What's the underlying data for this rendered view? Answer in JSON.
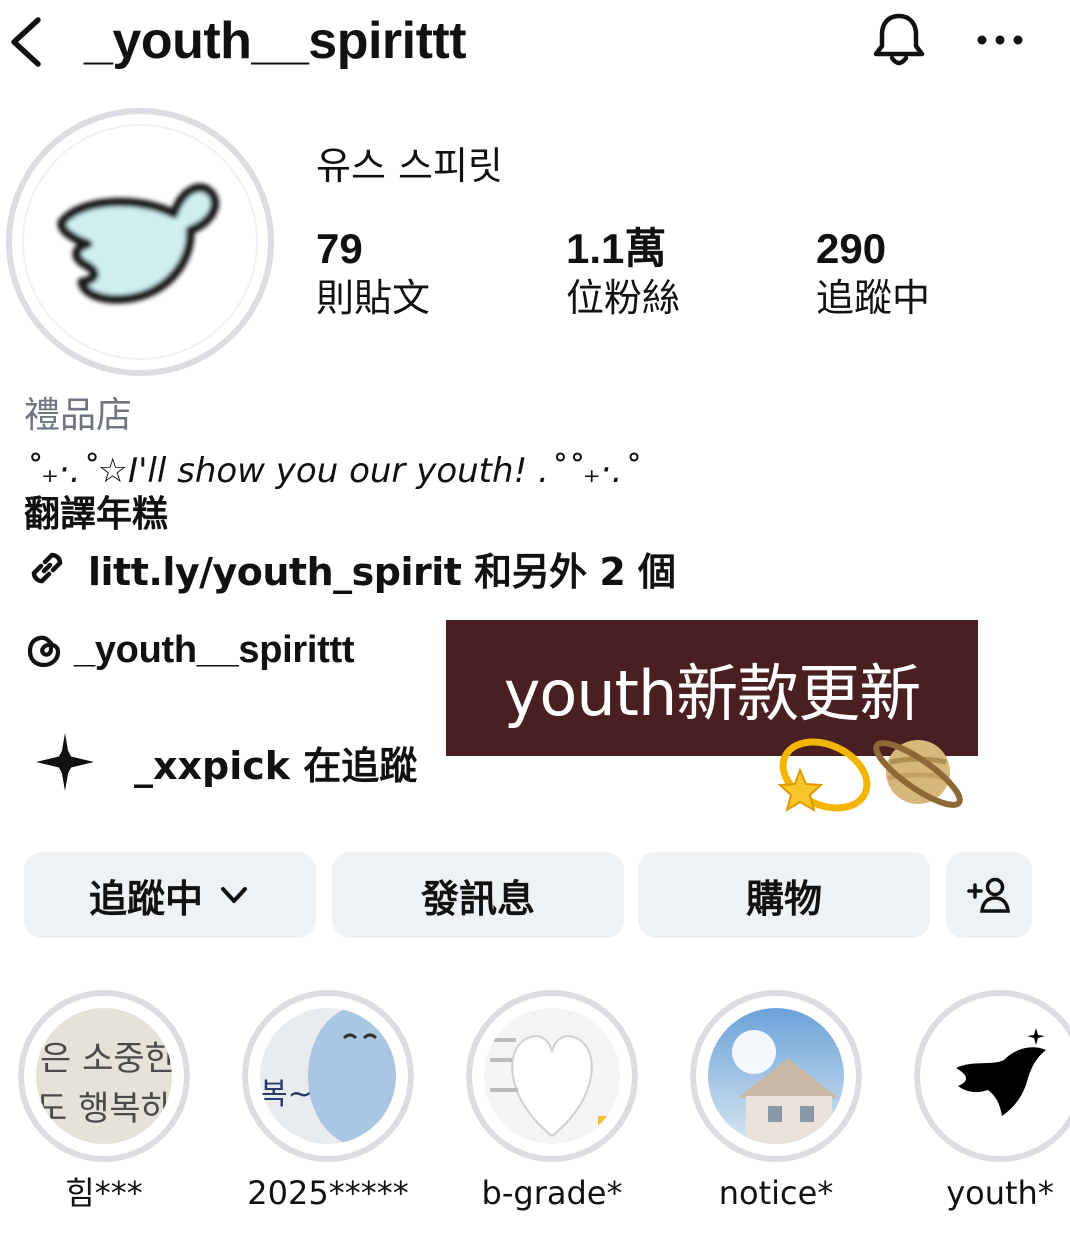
{
  "header": {
    "username": "_youth__spirittt",
    "icons": [
      "back-chevron-icon",
      "bell-icon",
      "more-icon"
    ]
  },
  "profile": {
    "display_name": "유스 스피릿",
    "stats": [
      {
        "value": "79",
        "label": "則貼文"
      },
      {
        "value": "1.1萬",
        "label": "位粉絲"
      },
      {
        "value": "290",
        "label": "追蹤中"
      }
    ]
  },
  "bio": {
    "category": "禮品店",
    "line1": "˚₊‧.˚☆I'll show you our youth! .˚˚₊‧.˚",
    "line2": "翻譯年糕",
    "link": "litt.ly/youth_spirit 和另外 2 個",
    "threads_handle": "_youth__spirittt",
    "followed_by": "_xxpick 在追蹤"
  },
  "banner": {
    "text": "youth新款更新",
    "background": "#4a1f21"
  },
  "buttons": {
    "following": "追蹤中",
    "message": "發訊息",
    "shop": "購物"
  },
  "highlights": [
    {
      "label": "힘***"
    },
    {
      "label": "2025*****"
    },
    {
      "label": "b-grade*"
    },
    {
      "label": "notice*"
    },
    {
      "label": "youth*"
    }
  ],
  "colors": {
    "button_bg": "#eff2f5",
    "ring": "#dbdde2",
    "muted_text": "#6e7480"
  }
}
